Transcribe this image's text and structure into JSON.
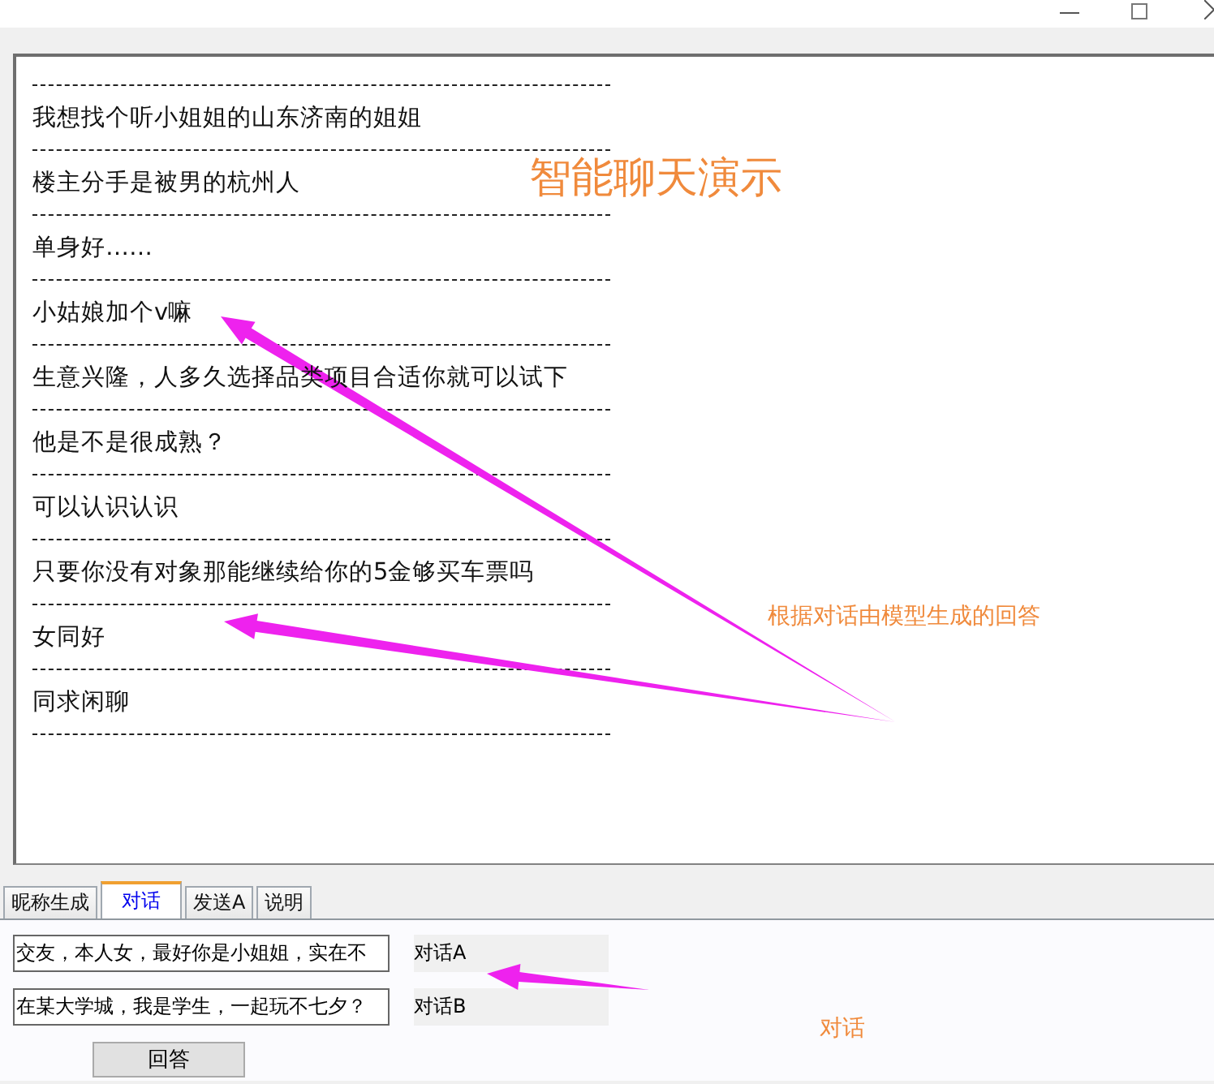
{
  "messages": [
    "我想找个听小姐姐的山东济南的姐姐",
    "楼主分手是被男的杭州人",
    "单身好……",
    "小姑娘加个v嘛",
    "生意兴隆，人多久选择品类项目合适你就可以试下",
    "他是不是很成熟？",
    "可以认识认识",
    "只要你没有对象那能继续给你的5金够买车票吗",
    "女同好",
    "同求闲聊"
  ],
  "annotations": {
    "title": "智能聊天演示",
    "reply_note": "根据对话由模型生成的回答",
    "dialog_note": "对话"
  },
  "tabs": [
    {
      "label": "昵称生成",
      "selected": false
    },
    {
      "label": "对话",
      "selected": true
    },
    {
      "label": "发送A",
      "selected": false
    },
    {
      "label": "说明",
      "selected": false
    }
  ],
  "dialog_fields": [
    {
      "value": "交友，本人女，最好你是小姐姐，实在不"
    },
    {
      "value": "在某大学城，我是学生，一起玩不七夕？"
    }
  ],
  "dialog_labels": [
    "对话A",
    "对话B"
  ],
  "answer_button": "回答"
}
